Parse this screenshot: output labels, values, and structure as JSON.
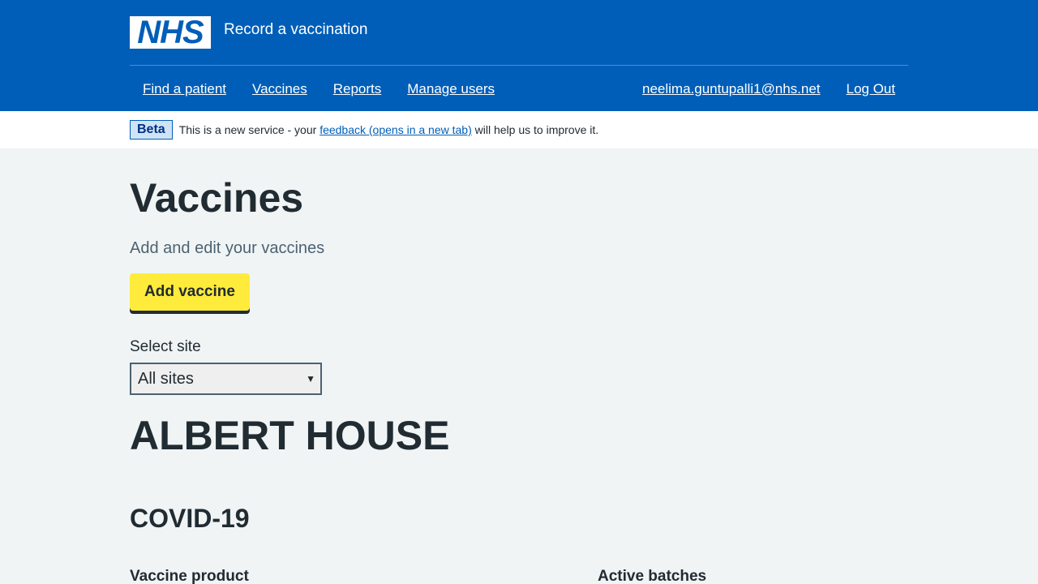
{
  "header": {
    "logo_text": "NHS",
    "service_name": "Record a vaccination",
    "nav_left": [
      "Find a patient",
      "Vaccines",
      "Reports",
      "Manage users"
    ],
    "nav_right": [
      "neelima.guntupalli1@nhs.net",
      "Log Out"
    ]
  },
  "beta": {
    "tag": "Beta",
    "text_before": "This is a new service - your",
    "link": "feedback (opens in a new tab)",
    "text_after": "will help us to improve it."
  },
  "main": {
    "title": "Vaccines",
    "lead": "Add and edit your vaccines",
    "add_button": "Add vaccine",
    "select_label": "Select site",
    "select_value": "All sites",
    "site_heading": "ALBERT HOUSE",
    "vaccine_type": "COVID-19",
    "table_headers": [
      "Vaccine product",
      "Active batches"
    ]
  },
  "colors": {
    "nhs_blue": "#005eb8",
    "button_yellow": "#ffeb3b",
    "background": "#f0f4f5"
  }
}
